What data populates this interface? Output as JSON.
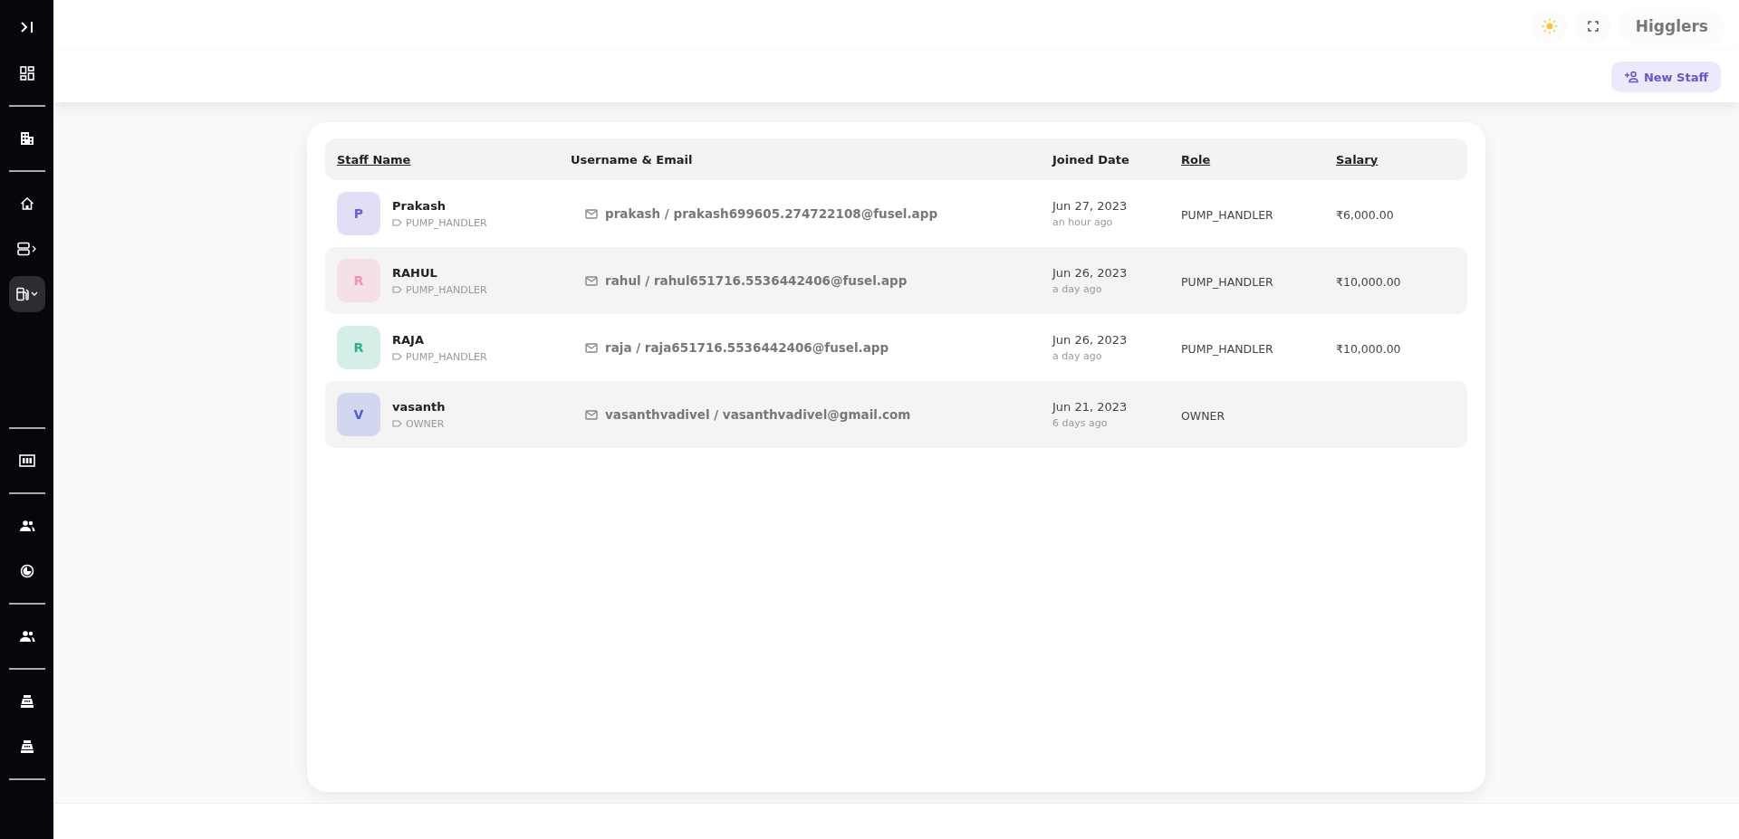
{
  "sidebar": {
    "groups": [
      [
        {
          "kind": "dashboard",
          "selected": false
        }
      ],
      [
        {
          "kind": "building",
          "selected": false
        }
      ],
      [
        {
          "kind": "home",
          "selected": false
        },
        {
          "kind": "server",
          "selected": false
        },
        {
          "kind": "fuel",
          "selected": true
        }
      ],
      [
        {
          "kind": "calculator",
          "selected": false
        }
      ],
      [
        {
          "kind": "people",
          "selected": false
        },
        {
          "kind": "chart",
          "selected": false
        }
      ],
      [
        {
          "kind": "people",
          "selected": false
        }
      ],
      [
        {
          "kind": "register",
          "selected": false
        },
        {
          "kind": "register",
          "selected": false
        }
      ]
    ]
  },
  "topbar": {
    "brand": "Higglers"
  },
  "toolbar": {
    "new_button": "New Staff"
  },
  "table": {
    "columns": [
      {
        "label": "Staff Name",
        "sortable": true
      },
      {
        "label": "Username & Email",
        "sortable": false
      },
      {
        "label": "Joined Date",
        "sortable": false
      },
      {
        "label": "Role",
        "sortable": true
      },
      {
        "label": "Salary",
        "sortable": true
      }
    ],
    "rows": [
      {
        "initial": "P",
        "color": "#6b5fd3",
        "name": "Prakash",
        "tag": "PUMP_HANDLER",
        "login": "prakash / prakash699605.274722108@fusel.app",
        "date": "Jun 27, 2023",
        "ago": "an hour ago",
        "role": "PUMP_HANDLER",
        "salary": "₹6,000.00"
      },
      {
        "initial": "R",
        "color": "#f58fb0",
        "name": "RAHUL",
        "tag": "PUMP_HANDLER",
        "login": "rahul / rahul651716.5536442406@fusel.app",
        "date": "Jun 26, 2023",
        "ago": "a day ago",
        "role": "PUMP_HANDLER",
        "salary": "₹10,000.00"
      },
      {
        "initial": "R",
        "color": "#2fb08a",
        "name": "RAJA",
        "tag": "PUMP_HANDLER",
        "login": "raja / raja651716.5536442406@fusel.app",
        "date": "Jun 26, 2023",
        "ago": "a day ago",
        "role": "PUMP_HANDLER",
        "salary": "₹10,000.00"
      },
      {
        "initial": "V",
        "color": "#4a5fd8",
        "name": "vasanth",
        "tag": "OWNER",
        "login": "vasanthvadivel / vasanthvadivel@gmail.com",
        "date": "Jun 21, 2023",
        "ago": "6 days ago",
        "role": "OWNER",
        "salary": ""
      }
    ]
  }
}
